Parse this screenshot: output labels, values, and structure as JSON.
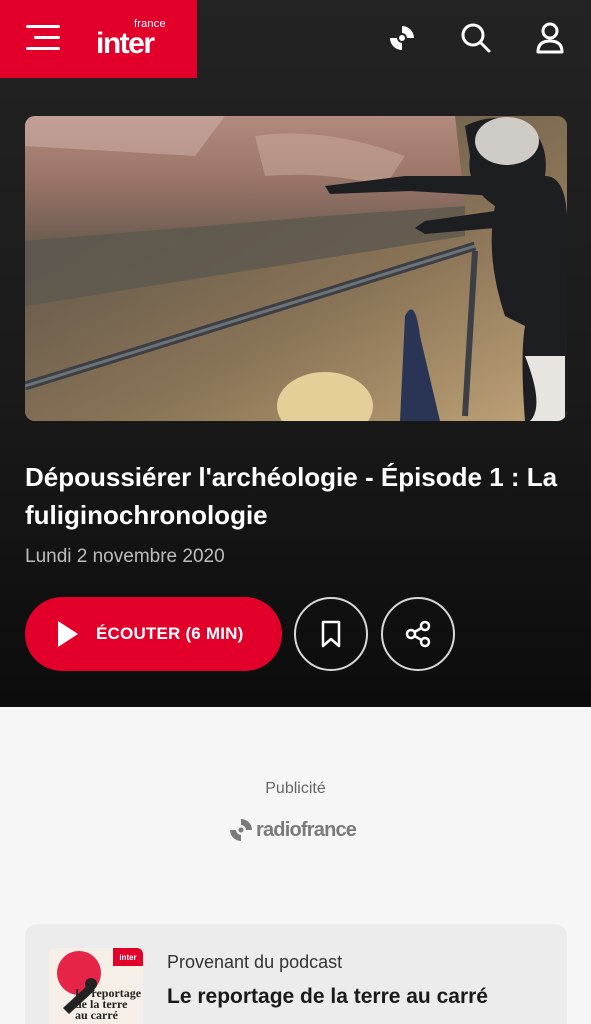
{
  "header": {
    "brand_small": "france",
    "brand_big": "inter",
    "icons": [
      "menu-icon",
      "radiofrance-icon",
      "search-icon",
      "account-icon"
    ]
  },
  "episode": {
    "title": "Dépoussiérer l'archéologie - Épisode 1 : La fuliginochronologie",
    "date": "Lundi 2 novembre 2020",
    "listen_label": "ÉCOUTER (6 MIN)"
  },
  "ad": {
    "label": "Publicité",
    "brand": "radiofrance"
  },
  "podcast": {
    "from_label": "Provenant du podcast",
    "name": "Le reportage de la terre au carré",
    "thumb_brand": "inter",
    "thumb_text": "Le reportage de la terre au carré"
  },
  "colors": {
    "accent": "#e2002b",
    "hero_bg": "#1a1a1a",
    "page_bg": "#f6f6f6"
  }
}
